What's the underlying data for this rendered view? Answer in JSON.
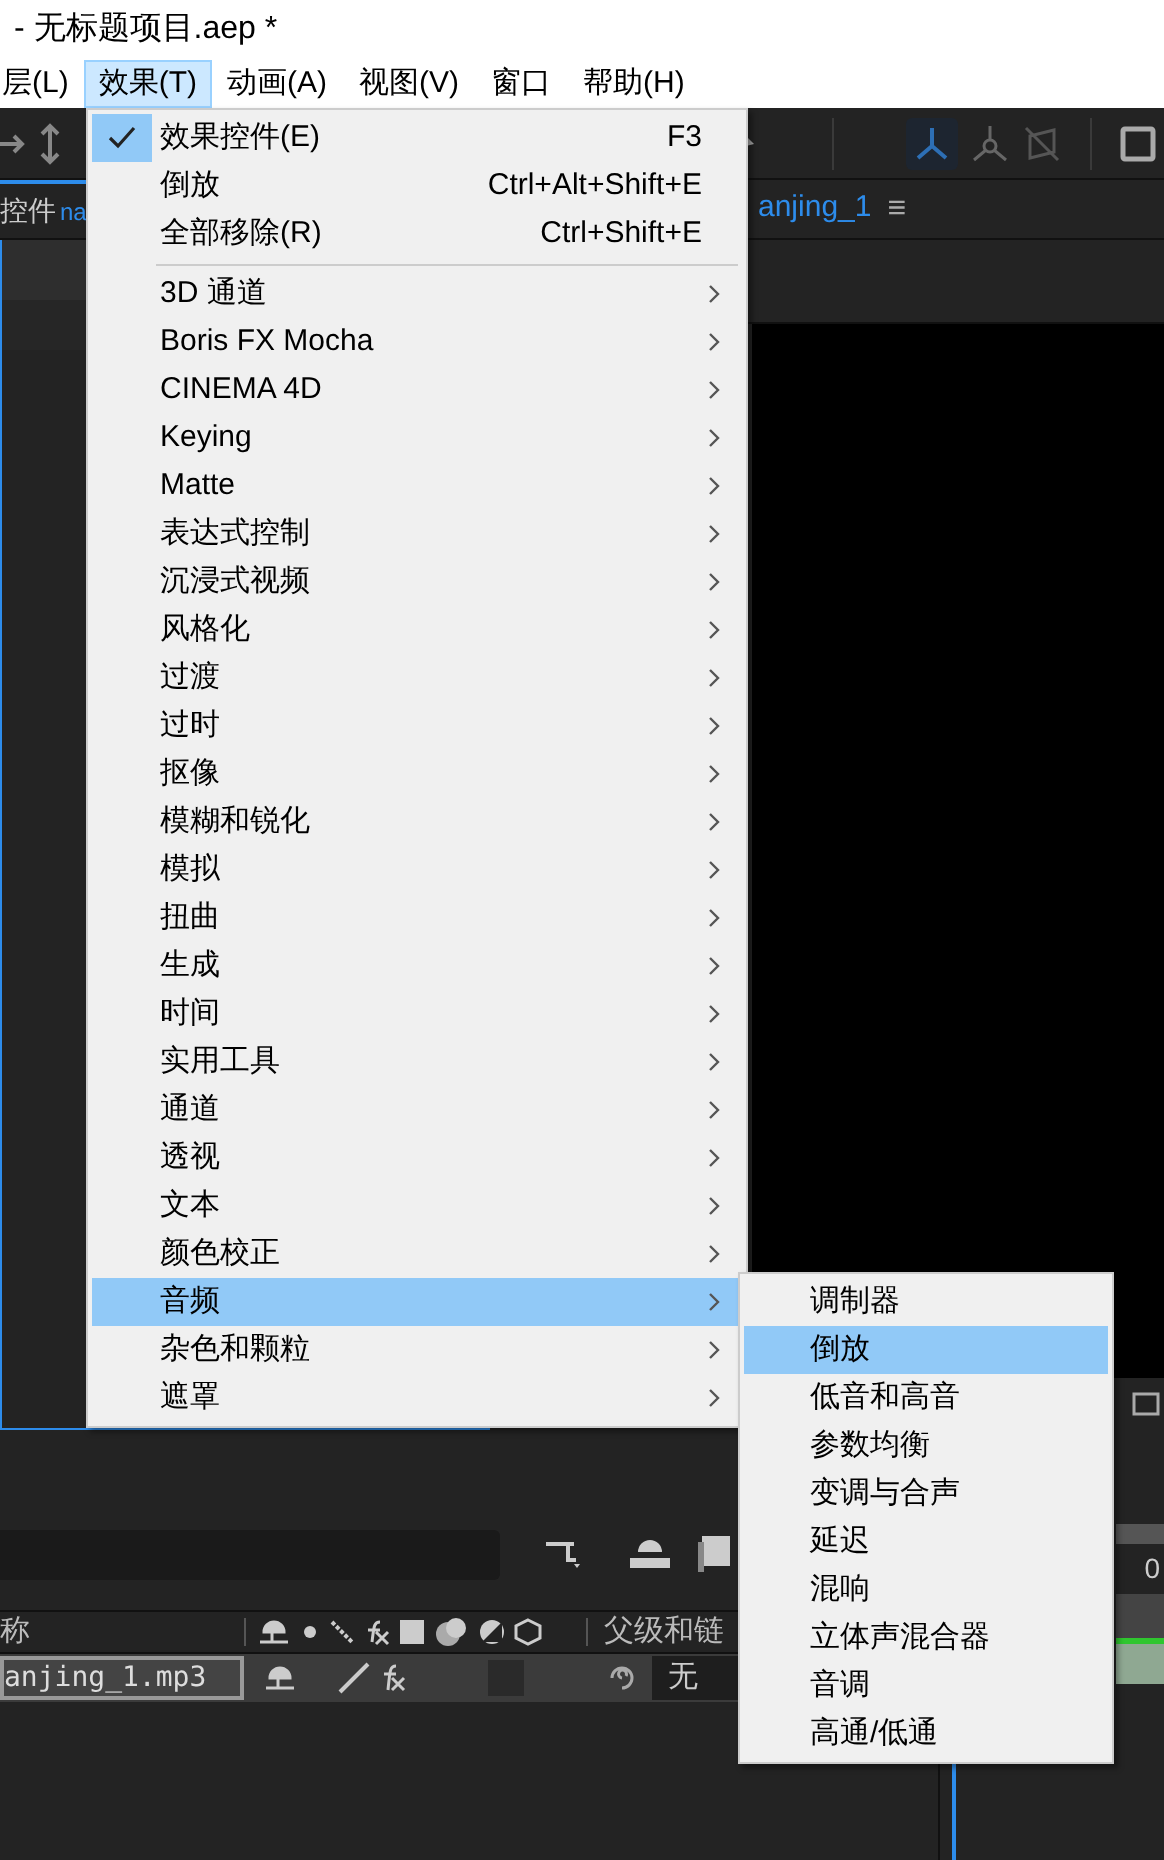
{
  "window": {
    "title": "- 无标题项目.aep *"
  },
  "menubar": [
    {
      "label": "层(L)",
      "selected": false
    },
    {
      "label": "效果(T)",
      "selected": true
    },
    {
      "label": "动画(A)",
      "selected": false
    },
    {
      "label": "视图(V)",
      "selected": false
    },
    {
      "label": "窗口",
      "selected": false
    },
    {
      "label": "帮助(H)",
      "selected": false
    }
  ],
  "panels": {
    "left_tab": "控件",
    "left_tab_link": "na",
    "right_tab": "anjing_1",
    "right_tab_menu": "≡"
  },
  "timeline": {
    "column_name": "称",
    "column_parent": "父级和链",
    "layer_name": "anjing_1.mp3",
    "layer_parent": "无",
    "time_readout": "0"
  },
  "menu": [
    {
      "kind": "command",
      "label": "效果控件(E)",
      "shortcut": "F3",
      "checked": true,
      "selected": false
    },
    {
      "kind": "command",
      "label": "倒放",
      "shortcut": "Ctrl+Alt+Shift+E",
      "checked": false,
      "selected": false
    },
    {
      "kind": "command",
      "label": "全部移除(R)",
      "shortcut": "Ctrl+Shift+E",
      "checked": false,
      "selected": false
    },
    {
      "kind": "separator"
    },
    {
      "kind": "submenu",
      "label": "3D 通道",
      "selected": false
    },
    {
      "kind": "submenu",
      "label": "Boris FX Mocha",
      "selected": false
    },
    {
      "kind": "submenu",
      "label": "CINEMA 4D",
      "selected": false
    },
    {
      "kind": "submenu",
      "label": "Keying",
      "selected": false
    },
    {
      "kind": "submenu",
      "label": "Matte",
      "selected": false
    },
    {
      "kind": "submenu",
      "label": "表达式控制",
      "selected": false
    },
    {
      "kind": "submenu",
      "label": "沉浸式视频",
      "selected": false
    },
    {
      "kind": "submenu",
      "label": "风格化",
      "selected": false
    },
    {
      "kind": "submenu",
      "label": "过渡",
      "selected": false
    },
    {
      "kind": "submenu",
      "label": "过时",
      "selected": false
    },
    {
      "kind": "submenu",
      "label": "抠像",
      "selected": false
    },
    {
      "kind": "submenu",
      "label": "模糊和锐化",
      "selected": false
    },
    {
      "kind": "submenu",
      "label": "模拟",
      "selected": false
    },
    {
      "kind": "submenu",
      "label": "扭曲",
      "selected": false
    },
    {
      "kind": "submenu",
      "label": "生成",
      "selected": false
    },
    {
      "kind": "submenu",
      "label": "时间",
      "selected": false
    },
    {
      "kind": "submenu",
      "label": "实用工具",
      "selected": false
    },
    {
      "kind": "submenu",
      "label": "通道",
      "selected": false
    },
    {
      "kind": "submenu",
      "label": "透视",
      "selected": false
    },
    {
      "kind": "submenu",
      "label": "文本",
      "selected": false
    },
    {
      "kind": "submenu",
      "label": "颜色校正",
      "selected": false
    },
    {
      "kind": "submenu",
      "label": "音频",
      "selected": true
    },
    {
      "kind": "submenu",
      "label": "杂色和颗粒",
      "selected": false
    },
    {
      "kind": "submenu",
      "label": "遮罩",
      "selected": false
    }
  ],
  "submenu": [
    {
      "label": "调制器",
      "selected": false
    },
    {
      "label": "倒放",
      "selected": true
    },
    {
      "label": "低音和高音",
      "selected": false
    },
    {
      "label": "参数均衡",
      "selected": false
    },
    {
      "label": "变调与合声",
      "selected": false
    },
    {
      "label": "延迟",
      "selected": false
    },
    {
      "label": "混响",
      "selected": false
    },
    {
      "label": "立体声混合器",
      "selected": false
    },
    {
      "label": "音调",
      "selected": false
    },
    {
      "label": "高通/低通",
      "selected": false
    }
  ]
}
